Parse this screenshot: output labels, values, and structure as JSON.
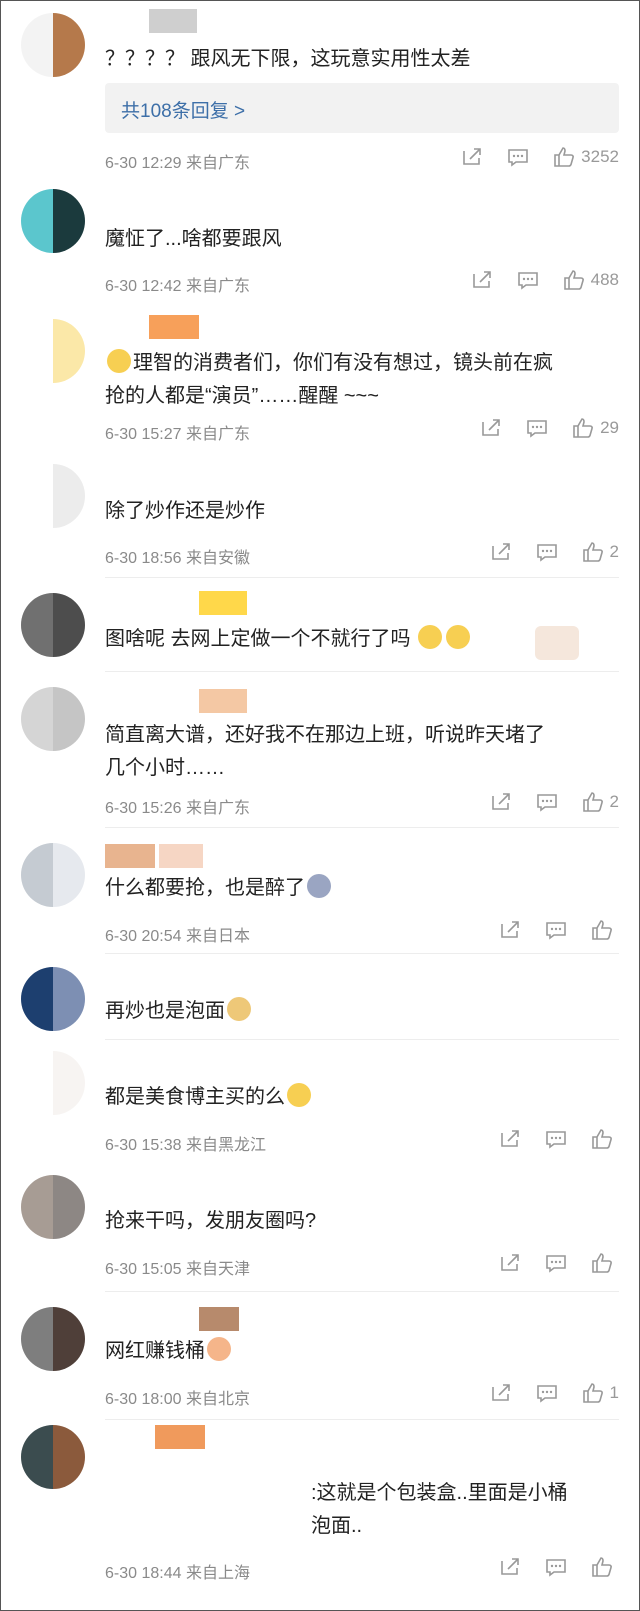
{
  "comments": [
    {
      "text": "？？？？ 跟风无下限，这玩意实用性太差",
      "replies": "共108条回复 >",
      "time": "6-30 12:29",
      "loc": "来自广东",
      "likes": "3252",
      "avatar": [
        "#f3f3f3",
        "#b5794b"
      ],
      "namecolors": [
        "#ffffff",
        "#bdbdbd"
      ]
    },
    {
      "text": "魔怔了...啥都要跟风",
      "time": "6-30 12:42",
      "loc": "来自广东",
      "likes": "488",
      "avatar": [
        "#5bc6cd",
        "#1b3a3d"
      ],
      "namecolors": [
        "#ffffff"
      ]
    },
    {
      "text": "理智的消费者们，你们有没有想过，镜头前在疯\n抢的人都是“演员”……醒醒 ~~~",
      "time": "6-30 15:27",
      "loc": "来自广东",
      "likes": "29",
      "avatar": [
        "#ffffff",
        "#fbe8a8"
      ],
      "namecolors": [
        "#f7a05a"
      ]
    },
    {
      "text": "除了炒作还是炒作",
      "time": "6-30 18:56",
      "loc": "来自安徽",
      "likes": "2",
      "avatar": [
        "#ffffff",
        "#ececec"
      ],
      "namecolors": [
        "#ffffff"
      ]
    },
    {
      "text": "图啥呢 去网上定做一个不就行了吗",
      "time": "",
      "loc": "",
      "likes": "",
      "avatar": [
        "#707070",
        "#4d4d4d"
      ],
      "namecolors": [
        "#ffffff",
        "#ffd84a"
      ]
    },
    {
      "text": "简直离大谱，还好我不在那边上班，听说昨天堵了\n几个小时……",
      "time": "6-30 15:26",
      "loc": "来自广东",
      "likes": "2",
      "avatar": [
        "#d5d5d5",
        "#c5c5c5"
      ],
      "namecolors": [
        "#ffffff",
        "#f4c8a4"
      ]
    },
    {
      "text": "什么都要抢，也是醉了",
      "time": "6-30 20:54",
      "loc": "来自日本",
      "likes": "",
      "avatar": [
        "#c5cbd2",
        "#e6e9ee"
      ],
      "namecolors": [
        "#e8b48f",
        "#f6d6c4"
      ]
    },
    {
      "text": "再炒也是泡面",
      "time": "",
      "loc": "",
      "likes": "",
      "avatar": [
        "#1d3f6f",
        "#7d8fb3"
      ],
      "namecolors": [
        "#ffffff"
      ]
    },
    {
      "text": "都是美食博主买的么",
      "time": "6-30 15:38",
      "loc": "来自黑龙江",
      "likes": "",
      "avatar": [
        "#ffffff",
        "#f7f4f2"
      ],
      "namecolors": [
        "#ffffff"
      ]
    },
    {
      "text": "抢来干吗，发朋友圈吗?",
      "time": "6-30 15:05",
      "loc": "来自天津",
      "likes": "",
      "avatar": [
        "#a79c94",
        "#8d8784"
      ],
      "namecolors": [
        "#ffffff"
      ]
    },
    {
      "text": "网红赚钱桶",
      "time": "6-30 18:00",
      "loc": "来自北京",
      "likes": "1",
      "avatar": [
        "#7e7e7e",
        "#4f3f39"
      ],
      "namecolors": [
        "#ffffff",
        "#b78a6c"
      ]
    },
    {
      "text": ":这就是个包装盒..里面是小桶\n泡面..",
      "time": "6-30 18:44",
      "loc": "来自上海",
      "likes": "",
      "avatar": [
        "#3b4c4f",
        "#8b5a3c"
      ],
      "namecolors": [
        "#ffffff",
        "#f09a5c"
      ]
    }
  ]
}
